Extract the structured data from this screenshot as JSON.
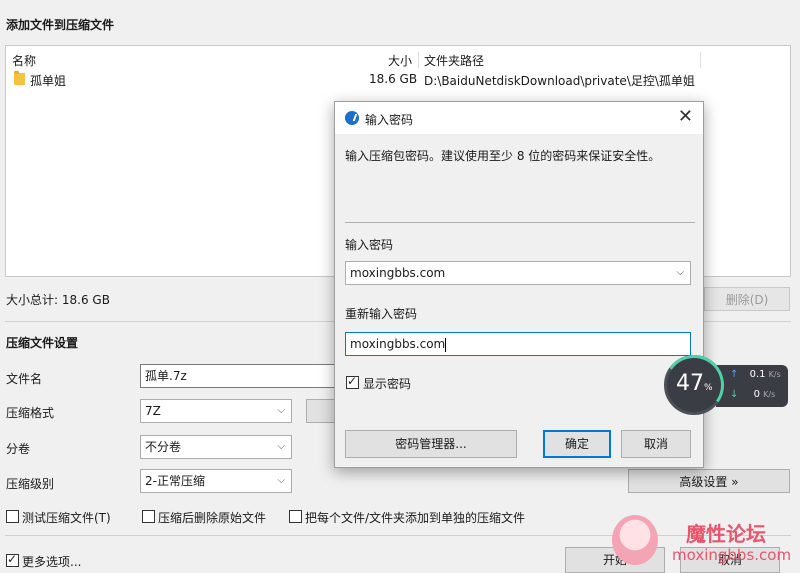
{
  "files_section": {
    "title": "添加文件到压缩文件",
    "columns": {
      "name": "名称",
      "size": "大小",
      "path": "文件夹路径"
    },
    "rows": [
      {
        "name": "孤单姐",
        "size": "18.6 GB",
        "path": "D:\\BaiduNetdiskDownload\\private\\足控\\孤单姐"
      }
    ],
    "total_size": "大小总计: 18.6 GB",
    "delete_button": "删除(D)"
  },
  "settings": {
    "title": "压缩文件设置",
    "filename_label": "文件名",
    "filename_value": "孤单.7z",
    "format_label": "压缩格式",
    "format_value": "7Z",
    "split_label": "分卷",
    "split_value": "不分卷",
    "level_label": "压缩级别",
    "level_value": "2-正常压缩",
    "advanced_button": "高级设置 »",
    "options": [
      {
        "label": "测试压缩文件(T)",
        "checked": false
      },
      {
        "label": "压缩后删除原始文件",
        "checked": false
      },
      {
        "label": "把每个文件/文件夹添加到单独的压缩文件",
        "checked": false
      }
    ],
    "more_options": {
      "label": "更多选项...",
      "checked": true
    },
    "start_button": "开始",
    "cancel_button": "取消"
  },
  "password_dialog": {
    "title": "输入密码",
    "description": "输入压缩包密码。建议使用至少 8 位的密码来保证安全性。",
    "password_label": "输入密码",
    "password_value": "moxingbbs.com",
    "confirm_label": "重新输入密码",
    "confirm_value": "moxingbbs.com",
    "show_password_label": "显示密码",
    "show_password_checked": true,
    "manager_button": "密码管理器...",
    "ok_button": "确定",
    "cancel_button": "取消"
  },
  "speed_widget": {
    "percent": "47",
    "percent_unit": "%",
    "upload": "0.1",
    "download": "0",
    "unit": "K/s"
  },
  "watermark": {
    "title": "魔性论坛",
    "url": "moxingbbs.com"
  },
  "colors": {
    "accent": "#0078d7",
    "watermark": "#e8556d",
    "widget_bg": "#3a3d44",
    "widget_arc": "#4fd1a8"
  }
}
